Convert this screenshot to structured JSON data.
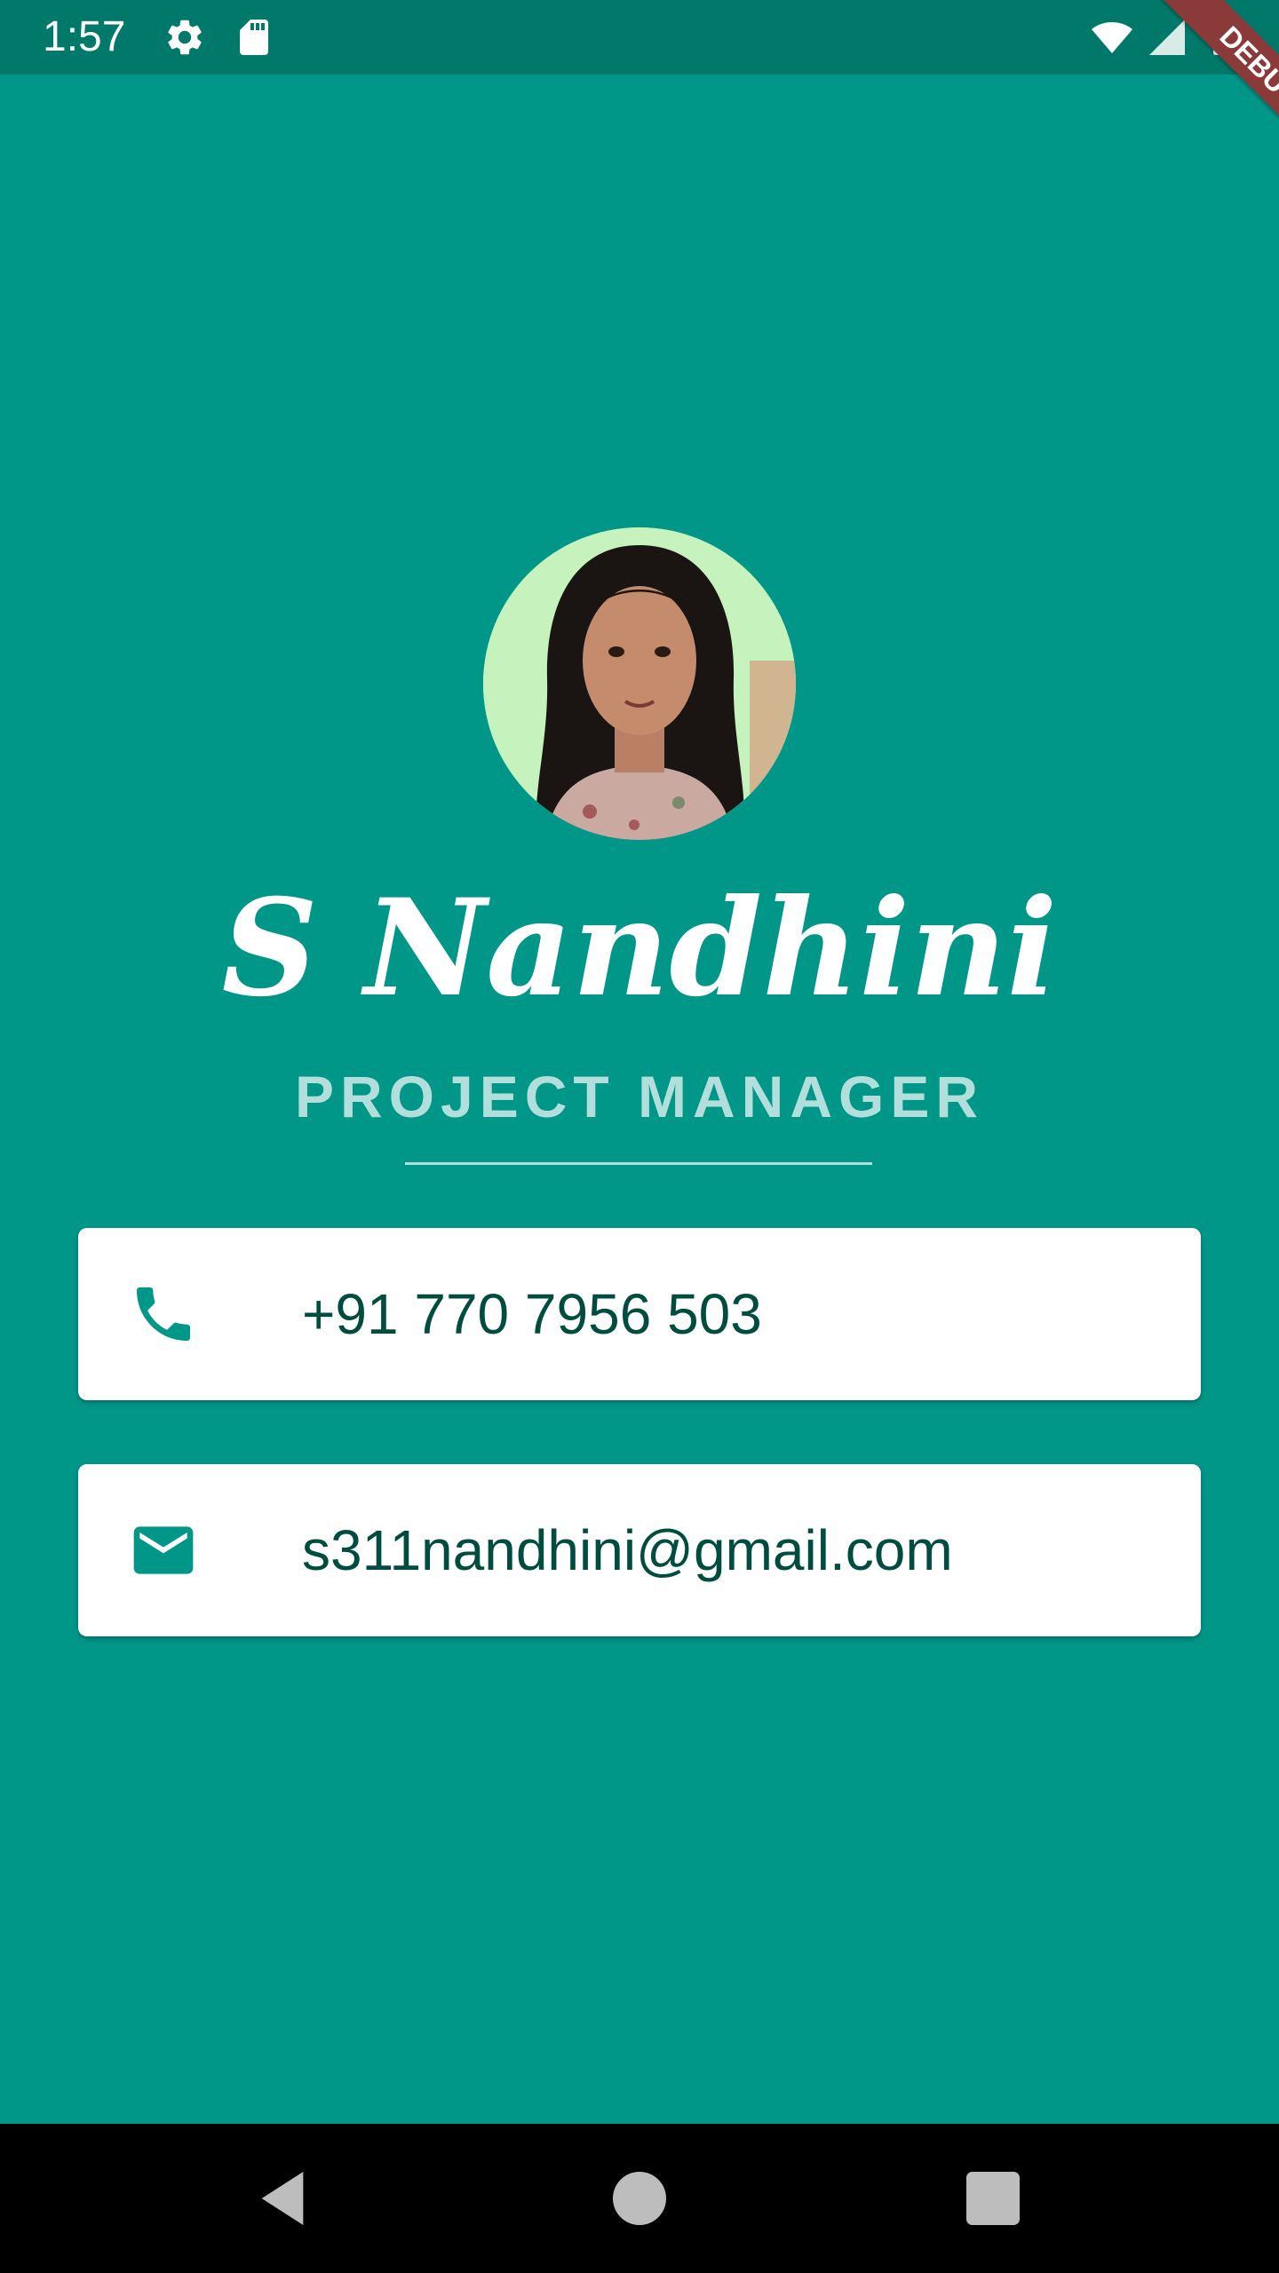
{
  "status_bar": {
    "time": "1:57",
    "icons": [
      "gear-icon",
      "sd-card-icon",
      "wifi-icon",
      "signal-icon",
      "battery-icon"
    ]
  },
  "debug_banner": {
    "label": "DEBUG"
  },
  "profile": {
    "avatar": "profile-photo",
    "name": "S Nandhini",
    "role": "PROJECT MANAGER"
  },
  "contacts": [
    {
      "icon": "phone-icon",
      "text": "+91 770 7956 503"
    },
    {
      "icon": "mail-icon",
      "text": "s311nandhini@gmail.com"
    }
  ],
  "nav_bar": {
    "buttons": [
      "back-icon",
      "home-icon",
      "recents-icon"
    ]
  },
  "colors": {
    "background": "#009688",
    "status_bar": "#00796b",
    "role_text": "#b2dfdb",
    "card_text": "#004d40",
    "icon": "#009688",
    "debug_ribbon": "#8b3a3a"
  }
}
